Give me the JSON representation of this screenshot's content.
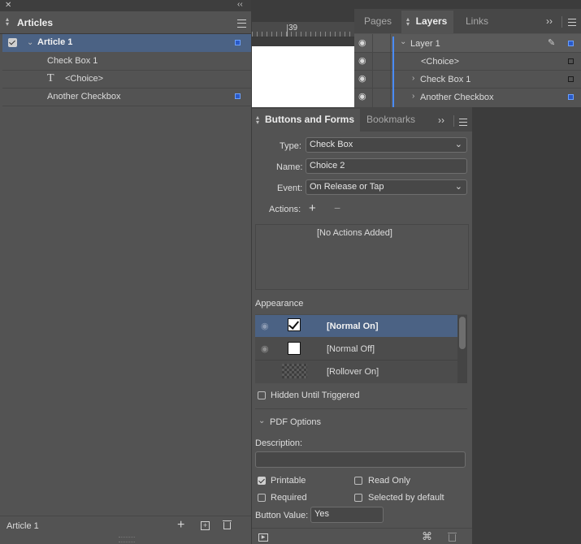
{
  "articles": {
    "title": "Articles",
    "rows": [
      {
        "label": "Article 1"
      },
      {
        "label": "Check Box 1"
      },
      {
        "label": "<Choice>"
      },
      {
        "label": "Another Checkbox"
      }
    ],
    "footer_label": "Article 1"
  },
  "ruler": {
    "tick_label": "39"
  },
  "layers_panel": {
    "tabs": [
      "Pages",
      "Layers",
      "Links"
    ],
    "rows": [
      {
        "label": "Layer 1"
      },
      {
        "label": "<Choice>"
      },
      {
        "label": "Check Box 1"
      },
      {
        "label": "Another Checkbox"
      }
    ]
  },
  "buttons_forms": {
    "tabs": [
      "Buttons and Forms",
      "Bookmarks"
    ],
    "type_label": "Type:",
    "type_value": "Check Box",
    "name_label": "Name:",
    "name_value": "Choice 2",
    "event_label": "Event:",
    "event_value": "On Release or Tap",
    "actions_label": "Actions:",
    "add_symbol": "+",
    "remove_symbol": "−",
    "no_actions": "[No Actions Added]",
    "appearance_label": "Appearance",
    "appearance_rows": [
      {
        "label": "[Normal On]"
      },
      {
        "label": "[Normal Off]"
      },
      {
        "label": "[Rollover On]"
      }
    ],
    "hidden_until_triggered": "Hidden Until Triggered",
    "pdf_options": "PDF Options",
    "description_label": "Description:",
    "description_value": "",
    "printable": "Printable",
    "read_only": "Read Only",
    "required": "Required",
    "selected_by_default": "Selected by default",
    "button_value_label": "Button Value:",
    "button_value": "Yes"
  },
  "colors": {
    "panel": "#535353",
    "selection": "#4b6284",
    "accent": "#4a8cff"
  }
}
